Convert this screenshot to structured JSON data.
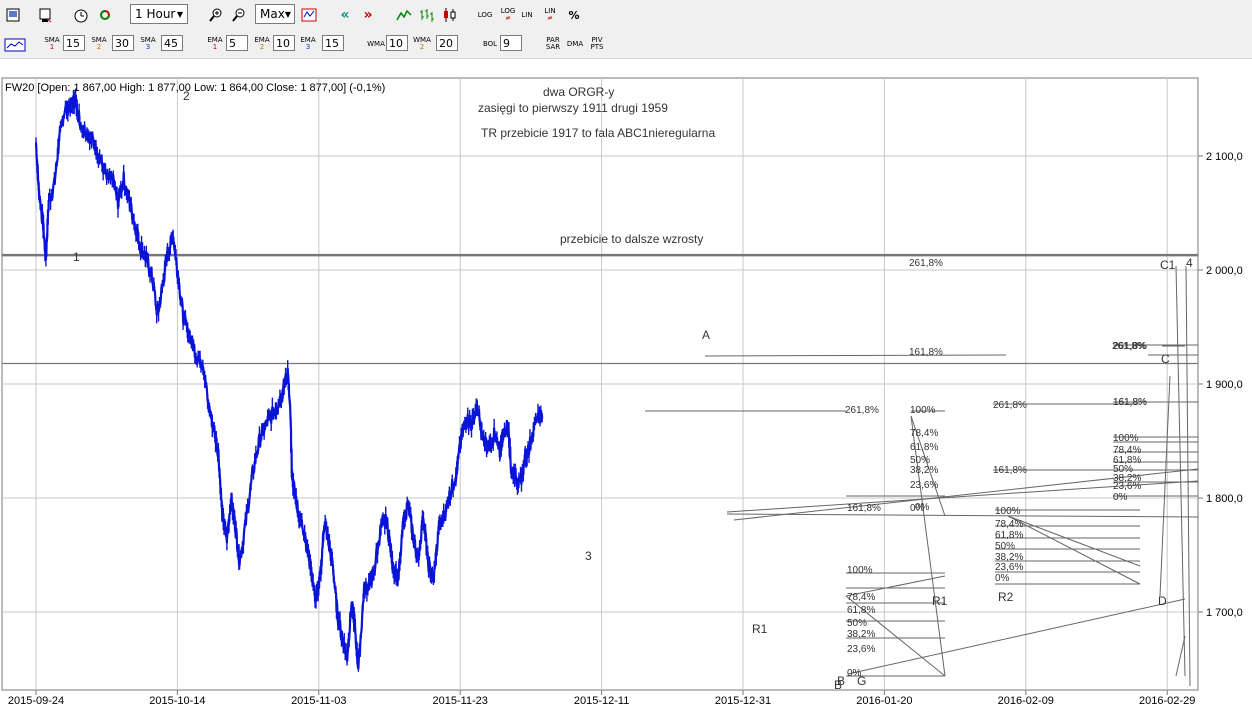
{
  "toolbar1": {
    "timeframe": "1 Hour",
    "range": "Max",
    "scale_buttons": [
      {
        "top": "LOG",
        "bottom": "",
        "state": "off"
      },
      {
        "top": "LOG",
        "bottom": "≠",
        "state": "off"
      },
      {
        "top": "LIN",
        "bottom": "",
        "state": "off"
      },
      {
        "top": "LIN",
        "bottom": "≠",
        "state": "off"
      },
      {
        "top": "%",
        "bottom": "",
        "state": "off"
      }
    ]
  },
  "toolbar2": {
    "indicators": [
      {
        "name": "SMA",
        "n": "1",
        "value": "15"
      },
      {
        "name": "SMA",
        "n": "2",
        "value": "30"
      },
      {
        "name": "SMA",
        "n": "3",
        "value": "45"
      },
      {
        "name": "EMA",
        "n": "1",
        "value": "5"
      },
      {
        "name": "EMA",
        "n": "2",
        "value": "10"
      },
      {
        "name": "EMA",
        "n": "3",
        "value": "15"
      },
      {
        "name": "WMA",
        "n": "",
        "value": "10"
      },
      {
        "name": "WMA",
        "n": "2",
        "value": "20"
      },
      {
        "name": "BOL",
        "n": "",
        "value": "9"
      }
    ],
    "extra": [
      {
        "top": "PAR",
        "bottom": "SAR"
      },
      {
        "top": "DMA",
        "bottom": ""
      },
      {
        "top": "PIV",
        "bottom": "PTS"
      }
    ]
  },
  "chart_data": {
    "type": "line",
    "header": "FW20 [Open: 1 867,00  High: 1 877,00  Low: 1 864,00  Close: 1 877,00] (-0,1%)",
    "series_color": "#0a14d8",
    "ylim": [
      1640,
      2130
    ],
    "yticks": [
      "2 100,0",
      "2 000,0",
      "1 900,0",
      "1 800,0",
      "1 700,0"
    ],
    "ytick_values": [
      2100,
      2000,
      1900,
      1800,
      1700
    ],
    "xticks": [
      "2015-09-24",
      "2015-10-14",
      "2015-11-03",
      "2015-11-23",
      "2015-12-11",
      "2015-12-31",
      "2016-01-20",
      "2016-02-09",
      "2016-02-29"
    ],
    "grid": true,
    "anchors": [
      [
        0,
        2112
      ],
      [
        0.02,
        2070
      ],
      [
        0.05,
        2040
      ],
      [
        0.07,
        2010
      ],
      [
        0.09,
        2060
      ],
      [
        0.13,
        2075
      ],
      [
        0.16,
        2110
      ],
      [
        0.2,
        2140
      ],
      [
        0.25,
        2145
      ],
      [
        0.28,
        2150
      ],
      [
        0.31,
        2130
      ],
      [
        0.36,
        2120
      ],
      [
        0.4,
        2115
      ],
      [
        0.45,
        2100
      ],
      [
        0.5,
        2080
      ],
      [
        0.54,
        2080
      ],
      [
        0.58,
        2060
      ],
      [
        0.62,
        2080
      ],
      [
        0.66,
        2060
      ],
      [
        0.7,
        2040
      ],
      [
        0.74,
        2020
      ],
      [
        0.78,
        2010
      ],
      [
        0.82,
        1995
      ],
      [
        0.86,
        1960
      ],
      [
        0.9,
        1990
      ],
      [
        0.93,
        2015
      ],
      [
        0.97,
        2030
      ],
      [
        1.0,
        2000
      ],
      [
        1.04,
        1960
      ],
      [
        1.09,
        1940
      ],
      [
        1.14,
        1925
      ],
      [
        1.18,
        1920
      ],
      [
        1.22,
        1880
      ],
      [
        1.26,
        1860
      ],
      [
        1.29,
        1840
      ],
      [
        1.32,
        1780
      ],
      [
        1.35,
        1765
      ],
      [
        1.38,
        1800
      ],
      [
        1.41,
        1775
      ],
      [
        1.44,
        1745
      ],
      [
        1.48,
        1775
      ],
      [
        1.53,
        1820
      ],
      [
        1.58,
        1850
      ],
      [
        1.63,
        1865
      ],
      [
        1.68,
        1875
      ],
      [
        1.72,
        1885
      ],
      [
        1.75,
        1895
      ],
      [
        1.78,
        1912
      ],
      [
        1.8,
        1870
      ],
      [
        1.81,
        1820
      ],
      [
        1.83,
        1805
      ],
      [
        1.86,
        1785
      ],
      [
        1.9,
        1770
      ],
      [
        1.94,
        1740
      ],
      [
        1.98,
        1710
      ],
      [
        2.01,
        1730
      ],
      [
        2.04,
        1780
      ],
      [
        2.07,
        1760
      ],
      [
        2.1,
        1740
      ],
      [
        2.13,
        1700
      ],
      [
        2.16,
        1680
      ],
      [
        2.2,
        1660
      ],
      [
        2.23,
        1705
      ],
      [
        2.25,
        1695
      ],
      [
        2.28,
        1650
      ],
      [
        2.32,
        1720
      ],
      [
        2.36,
        1725
      ],
      [
        2.39,
        1735
      ],
      [
        2.44,
        1775
      ],
      [
        2.48,
        1780
      ],
      [
        2.52,
        1745
      ],
      [
        2.56,
        1725
      ],
      [
        2.6,
        1780
      ],
      [
        2.63,
        1795
      ],
      [
        2.67,
        1765
      ],
      [
        2.7,
        1745
      ],
      [
        2.74,
        1785
      ],
      [
        2.77,
        1745
      ],
      [
        2.81,
        1725
      ],
      [
        2.85,
        1775
      ],
      [
        2.89,
        1785
      ],
      [
        2.93,
        1805
      ],
      [
        2.97,
        1820
      ],
      [
        3.0,
        1845
      ],
      [
        3.04,
        1870
      ],
      [
        3.08,
        1865
      ],
      [
        3.12,
        1880
      ],
      [
        3.16,
        1850
      ],
      [
        3.2,
        1845
      ],
      [
        3.24,
        1855
      ],
      [
        3.28,
        1840
      ],
      [
        3.3,
        1855
      ],
      [
        3.34,
        1865
      ],
      [
        3.36,
        1825
      ],
      [
        3.39,
        1820
      ],
      [
        3.42,
        1810
      ],
      [
        3.46,
        1835
      ],
      [
        3.5,
        1850
      ],
      [
        3.55,
        1875
      ],
      [
        3.58,
        1870
      ]
    ],
    "hlines": [
      {
        "value": 2013,
        "x0": 0.0,
        "x1": 1.0,
        "width": 2.5,
        "color": "#777777"
      },
      {
        "value": 1918,
        "x0": 0.0,
        "x1": 1.0,
        "width": 1.2,
        "color": "#777777"
      }
    ],
    "annotations": {
      "top_notes": [
        "dwa  ORGR-y",
        "zasięgi to  pierwszy 1911 drugi 1959",
        "TR przebicie 1917  to  fala ABC1nieregularna"
      ],
      "break_note": "przebicie to dalsze wzrosty",
      "wave_labels": [
        "1",
        "2",
        "3",
        "A",
        "R1",
        "R1",
        "R2",
        "B",
        "G",
        "C1",
        "4",
        "C",
        "D",
        "B"
      ],
      "fib_labels": [
        "261,8%",
        "161,8%",
        "261,8%",
        "100%",
        "78,4%",
        "61,8%",
        "50%",
        "38,2%",
        "23,6%",
        "0%",
        "161,8%",
        "0%",
        "100%",
        "78,4%",
        "61,8%",
        "50%",
        "38,2%",
        "23,6%",
        "0%",
        "261,8%",
        "161,8%",
        "100%",
        "78,4%",
        "61,8%",
        "50%",
        "38,2%",
        "23,6%",
        "0%",
        "261,8%",
        "161,8%",
        "261,8%",
        "161,8%",
        "100%",
        "78,4%",
        "61,8%",
        "50%",
        "38,2%",
        "23,6%",
        "0%"
      ]
    }
  }
}
